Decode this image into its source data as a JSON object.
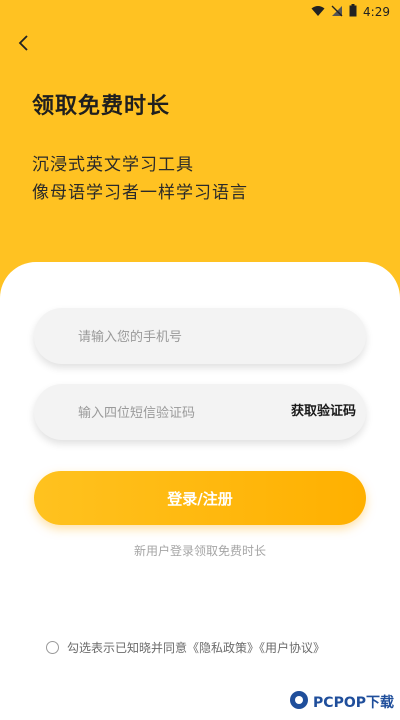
{
  "status_bar": {
    "time": "4:29"
  },
  "header": {
    "title": "领取免费时长",
    "subtitle_line1": "沉浸式英文学习工具",
    "subtitle_line2": "像母语学习者一样学习语言"
  },
  "form": {
    "phone_placeholder": "请输入您的手机号",
    "code_placeholder": "输入四位短信验证码",
    "get_code_label": "获取验证码",
    "login_label": "登录/注册",
    "hint": "新用户登录领取免费时长"
  },
  "agreement": {
    "text": "勾选表示已知晓并同意《隐私政策》《用户协议》"
  },
  "watermark": {
    "text": "PCPOP下载"
  },
  "colors": {
    "accent": "#ffc222",
    "button": "#ffb000"
  }
}
